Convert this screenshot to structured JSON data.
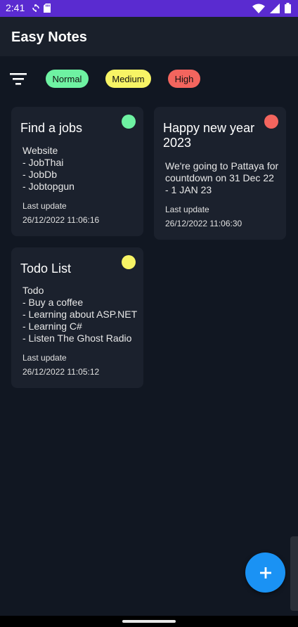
{
  "status_bar": {
    "time": "2:41",
    "left_icons": [
      "sync-icon",
      "sd-card-icon"
    ],
    "right_icons": [
      "wifi-icon",
      "cellular-signal-icon",
      "battery-icon"
    ],
    "background_color": "#5a2bd0"
  },
  "app_bar": {
    "title": "Easy Notes"
  },
  "filter": {
    "icon": "filter-list-icon",
    "chips": [
      {
        "label": "Normal",
        "color": "#6ef2a2"
      },
      {
        "label": "Medium",
        "color": "#f7f465"
      },
      {
        "label": "High",
        "color": "#f3655e"
      }
    ]
  },
  "notes": [
    {
      "title": "Find a jobs",
      "body": "Website\n- JobThai\n- JobDb\n- Jobtopgun",
      "priority_color": "#6ef2a2",
      "last_update_label": "Last update",
      "last_update": "26/12/2022 11:06:16"
    },
    {
      "title": "Happy new year\n2023",
      "body": "We're going to Pattaya for\ncountdown on 31 Dec 22\n- 1 JAN 23",
      "priority_color": "#f3655e",
      "last_update_label": "Last update",
      "last_update": "26/12/2022 11:06:30"
    },
    {
      "title": "Todo List",
      "body": "Todo\n- Buy a coffee\n- Learning about ASP.NET\n- Learning C#\n- Listen The Ghost Radio",
      "priority_color": "#f7f465",
      "last_update_label": "Last update",
      "last_update": "26/12/2022 11:05:12"
    }
  ],
  "fab": {
    "icon": "plus-icon",
    "color": "#1a92f4"
  },
  "colors": {
    "background": "#111722",
    "card": "#1b212d",
    "app_bar": "#1a202b"
  }
}
